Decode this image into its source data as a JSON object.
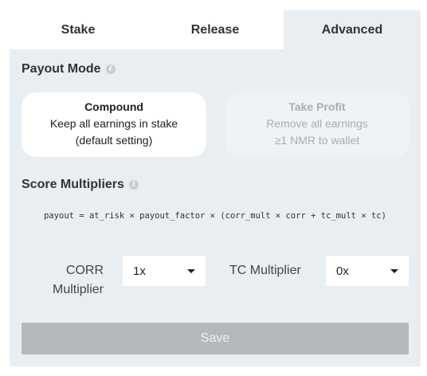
{
  "tabs": [
    {
      "label": "Stake"
    },
    {
      "label": "Release"
    },
    {
      "label": "Advanced"
    }
  ],
  "payout_mode": {
    "title": "Payout Mode",
    "info_icon": "info-icon",
    "options": [
      {
        "title": "Compound",
        "line1": "Keep all earnings in stake",
        "line2": "(default setting)",
        "selected": true
      },
      {
        "title": "Take Profit",
        "line1": "Remove all earnings",
        "line2": "≥1 NMR to wallet",
        "selected": false
      }
    ]
  },
  "score_multipliers": {
    "title": "Score Multipliers",
    "formula": "payout = at_risk × payout_factor × (corr_mult × corr + tc_mult × tc)",
    "corr": {
      "label_line1": "CORR",
      "label_line2": "Multiplier",
      "value": "1x"
    },
    "tc": {
      "label": "TC Multiplier",
      "value": "0x"
    }
  },
  "save_label": "Save",
  "colors": {
    "panel_bg": "#e8eef1",
    "save_disabled_bg": "#b4b9bd"
  }
}
